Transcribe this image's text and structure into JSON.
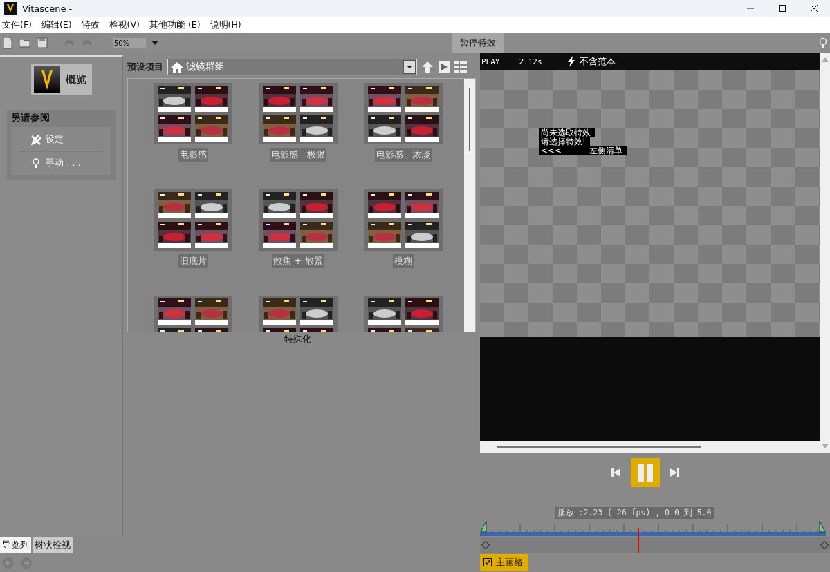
{
  "window": {
    "title": "Vitascene -"
  },
  "menu": [
    "文件(F)",
    "编辑(E)",
    "特效",
    "检视(V)",
    "其他功能 (E)",
    "说明(H)"
  ],
  "toolbar": {
    "zoom": "50%",
    "undo_disabled": true,
    "redo_disabled": true,
    "pause_effects": "暂停特效"
  },
  "sidebar": {
    "overview": "概览",
    "see_also_title": "另请参阅",
    "links": [
      {
        "label": "设定",
        "kind": "settings"
      },
      {
        "label": "手动 . . .",
        "kind": "manual"
      }
    ]
  },
  "bottom_tabs": [
    {
      "label": "导览列",
      "selected": true
    },
    {
      "label": "树状检视",
      "selected": false
    }
  ],
  "presets_header": {
    "label": "预设项目",
    "group": "滤镜群组"
  },
  "presets": [
    {
      "kind": "thumbnail",
      "label": "电影感"
    },
    {
      "kind": "thumbnail",
      "label": "电影感 - 极限"
    },
    {
      "kind": "thumbnail",
      "label": "电影感 - 浓淡"
    },
    {
      "kind": "thumbnail",
      "label": "旧底片"
    },
    {
      "kind": "thumbnail",
      "label": "散焦 + 散景"
    },
    {
      "kind": "thumbnail",
      "label": "模糊"
    },
    {
      "kind": "thumbnail"
    },
    {
      "kind": "thumbnail"
    },
    {
      "kind": "thumbnail"
    }
  ],
  "below_list_label": "特殊化",
  "preview": {
    "mode": "PLAY",
    "time": "2.12s",
    "template": "不含范本",
    "message": [
      "尚未选取特效",
      "请选择特效!",
      "<<<——— 左侧清单"
    ]
  },
  "playback": {
    "playing": true,
    "status": "播放 :2.23 ( 26 fps) ,  0.0 到 5.0",
    "level": 0.45
  },
  "keyframe": {
    "label": "主画格",
    "checked": true
  }
}
